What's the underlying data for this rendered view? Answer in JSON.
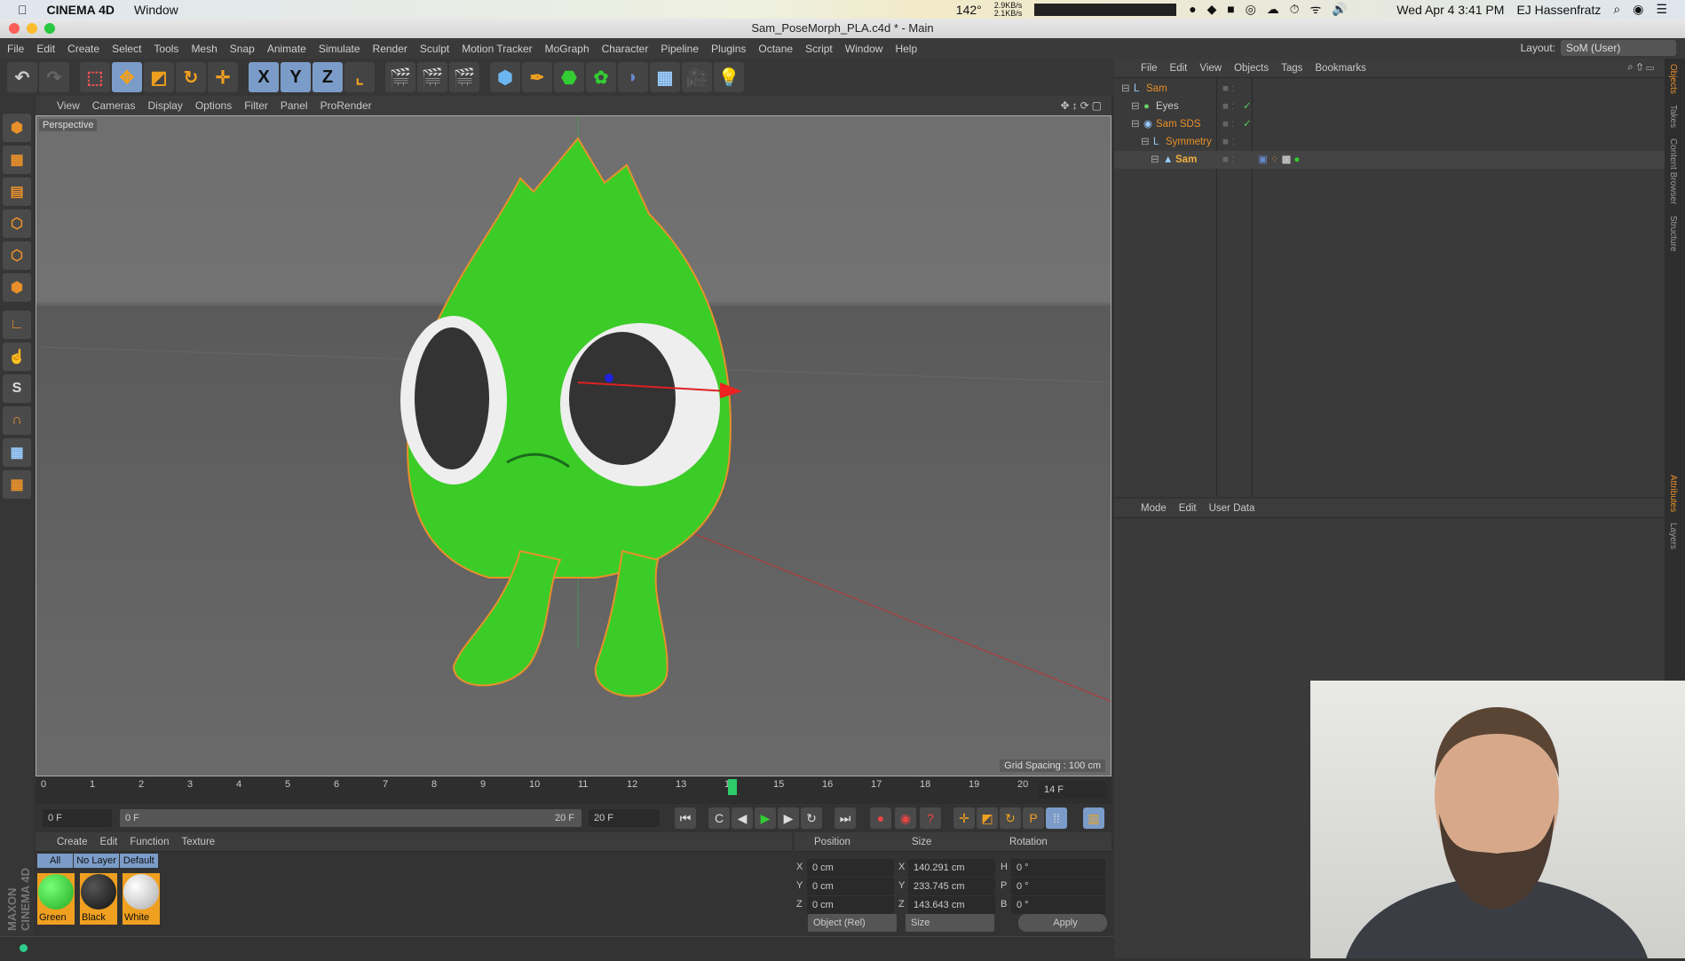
{
  "macbar": {
    "app": "CINEMA 4D",
    "menu": "Window",
    "temp": "142°",
    "net_up": "2.9KB/s",
    "net_down": "2.1KB/s",
    "datetime": "Wed Apr 4  3:41 PM",
    "user": "EJ Hassenfratz"
  },
  "window": {
    "title": "Sam_PoseMorph_PLA.c4d * - Main"
  },
  "menu": [
    "File",
    "Edit",
    "Create",
    "Select",
    "Tools",
    "Mesh",
    "Snap",
    "Animate",
    "Simulate",
    "Render",
    "Sculpt",
    "Motion Tracker",
    "MoGraph",
    "Character",
    "Pipeline",
    "Plugins",
    "Octane",
    "Script",
    "Window",
    "Help"
  ],
  "layout": {
    "label": "Layout:",
    "value": "SoM (User)"
  },
  "toolbar": {
    "x": "X",
    "y": "Y",
    "z": "Z"
  },
  "viewport": {
    "menu": [
      "View",
      "Cameras",
      "Display",
      "Options",
      "Filter",
      "Panel",
      "ProRender"
    ],
    "name": "Perspective",
    "grid_spacing": "Grid Spacing : 100 cm"
  },
  "timeline": {
    "ticks": [
      "0",
      "1",
      "2",
      "3",
      "4",
      "5",
      "6",
      "7",
      "8",
      "9",
      "10",
      "11",
      "12",
      "13",
      "14",
      "15",
      "16",
      "17",
      "18",
      "19",
      "20"
    ],
    "current": "14",
    "current_field": "14 F"
  },
  "controls": {
    "start": "0 F",
    "range_start": "0 F",
    "range_end": "20 F",
    "end": "20 F"
  },
  "materials": {
    "menu": [
      "Create",
      "Edit",
      "Function",
      "Texture"
    ],
    "filters": [
      "All",
      "No Layer",
      "Default"
    ],
    "items": [
      {
        "name": "Green",
        "color": "#3cc43c"
      },
      {
        "name": "Black",
        "color": "#222222"
      },
      {
        "name": "White",
        "color": "#f0f0f0"
      }
    ]
  },
  "coords": {
    "headers": [
      "Position",
      "Size",
      "Rotation"
    ],
    "rows": [
      {
        "a": "X",
        "pos": "0 cm",
        "b": "X",
        "size": "140.291 cm",
        "c": "H",
        "rot": "0 °"
      },
      {
        "a": "Y",
        "pos": "0 cm",
        "b": "Y",
        "size": "233.745 cm",
        "c": "P",
        "rot": "0 °"
      },
      {
        "a": "Z",
        "pos": "0 cm",
        "b": "Z",
        "size": "143.643 cm",
        "c": "B",
        "rot": "0 °"
      }
    ],
    "mode": "Object (Rel)",
    "size_mode": "Size",
    "apply": "Apply"
  },
  "objects": {
    "menu": [
      "File",
      "Edit",
      "View",
      "Objects",
      "Tags",
      "Bookmarks"
    ],
    "items": [
      {
        "name": "Sam",
        "indent": 0,
        "color": "#e8902a"
      },
      {
        "name": "Eyes",
        "indent": 1,
        "color": "#cccccc"
      },
      {
        "name": "Sam SDS",
        "indent": 1,
        "color": "#e8902a"
      },
      {
        "name": "Symmetry",
        "indent": 2,
        "color": "#e8902a"
      },
      {
        "name": "Sam",
        "indent": 3,
        "color": "#f0b040"
      }
    ]
  },
  "attributes": {
    "menu": [
      "Mode",
      "Edit",
      "User Data"
    ]
  },
  "sidetabs": [
    "Objects",
    "Takes",
    "Content Browser",
    "Structure",
    "Attributes",
    "Layers"
  ],
  "brand": "MAXON CINEMA 4D",
  "colors": {
    "accent": "#e8902a",
    "selected": "#7b9cc8",
    "character": "#3cc43c"
  }
}
